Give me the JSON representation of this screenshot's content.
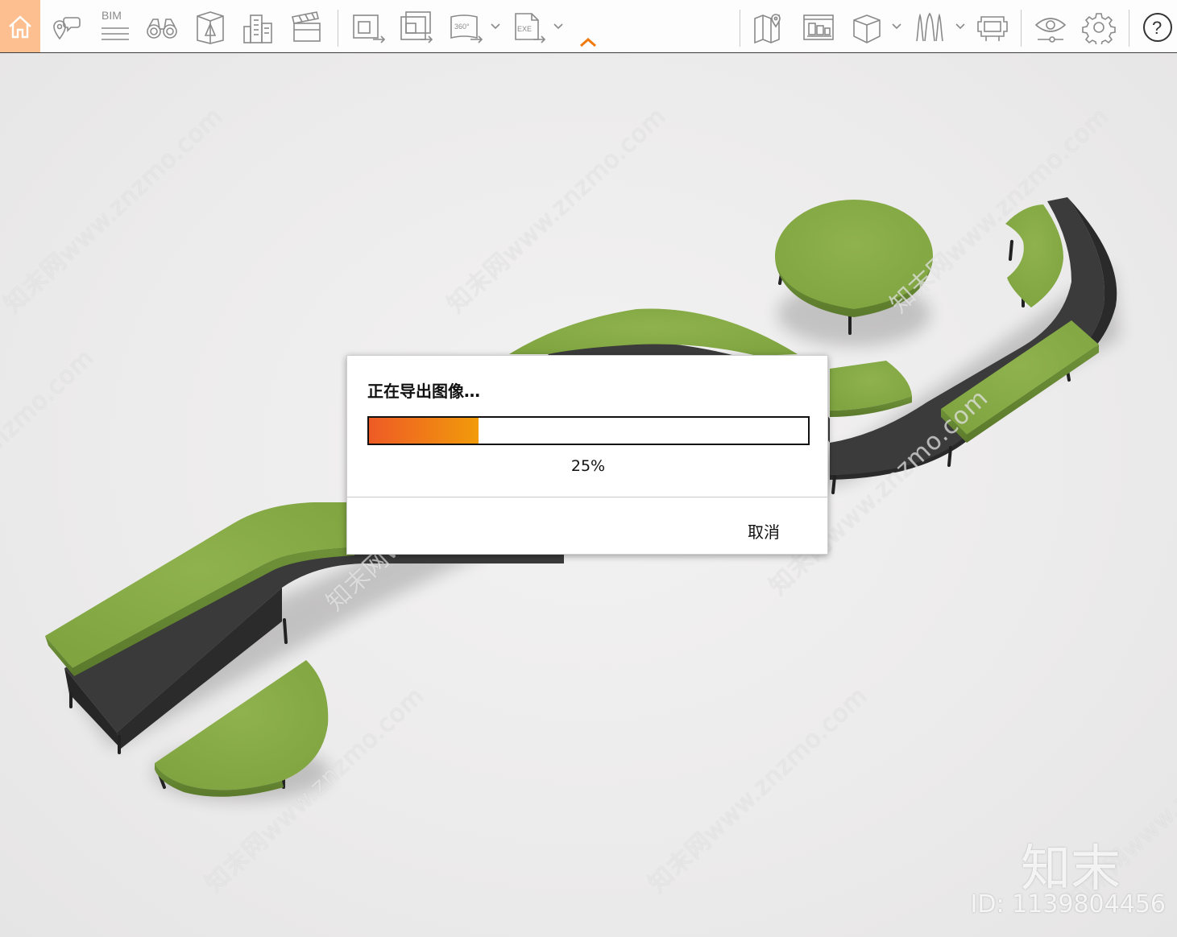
{
  "toolbar": {
    "home_icon": "home-icon",
    "bim_label": "BIM",
    "vr360_label": "360°",
    "exe_label": "EXE",
    "help_label": "?",
    "accent_color": "#f07a0d",
    "home_bg": "#fdbf8f"
  },
  "dialog": {
    "title": "正在导出图像…",
    "progress": 0.25,
    "progress_text": "25%",
    "cancel_label": "取消"
  },
  "watermarks": {
    "site": "知末网www.znzmo.com",
    "brand": "知末",
    "id_text": "ID: 1139804456"
  }
}
